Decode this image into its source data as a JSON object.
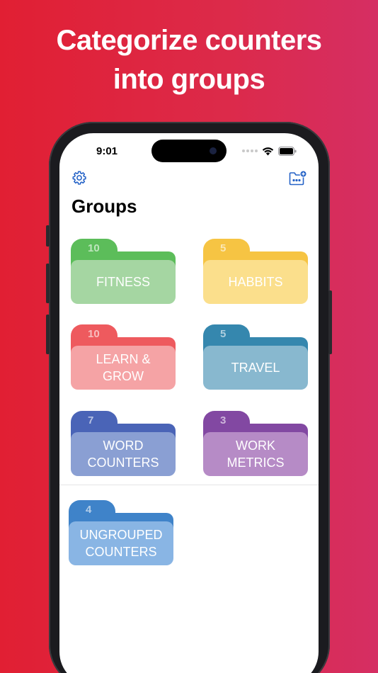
{
  "headline": {
    "line1": "Categorize counters",
    "line2": "into groups"
  },
  "status_bar": {
    "time": "9:01"
  },
  "header": {
    "title": "Groups",
    "left_icon": "gear-icon",
    "right_icon": "folder-add-icon"
  },
  "groups": [
    {
      "count": "10",
      "label": "FITNESS",
      "color_front": "#a5d6a2",
      "color_back": "#5cbd5a",
      "color_tab": "#5cbd5a"
    },
    {
      "count": "5",
      "label": "HABBITS",
      "color_front": "#fbdf8c",
      "color_back": "#f6c443",
      "color_tab": "#f6c443"
    },
    {
      "count": "10",
      "label": "LEARN & GROW",
      "color_front": "#f5a3a5",
      "color_back": "#ee5a5e",
      "color_tab": "#ee5a5e"
    },
    {
      "count": "5",
      "label": "TRAVEL",
      "color_front": "#88b8cf",
      "color_back": "#3587ae",
      "color_tab": "#3587ae"
    },
    {
      "count": "7",
      "label": "WORD COUNTERS",
      "color_front": "#8a9fd3",
      "color_back": "#4a64b7",
      "color_tab": "#4a64b7"
    },
    {
      "count": "3",
      "label": "WORK METRICS",
      "color_front": "#b68bc6",
      "color_back": "#8248a2",
      "color_tab": "#8248a2"
    }
  ],
  "ungrouped": {
    "count": "4",
    "label": "UNGROUPED COUNTERS",
    "color_front": "#89b5e4",
    "color_back": "#3f83c9",
    "color_tab": "#3f83c9"
  }
}
